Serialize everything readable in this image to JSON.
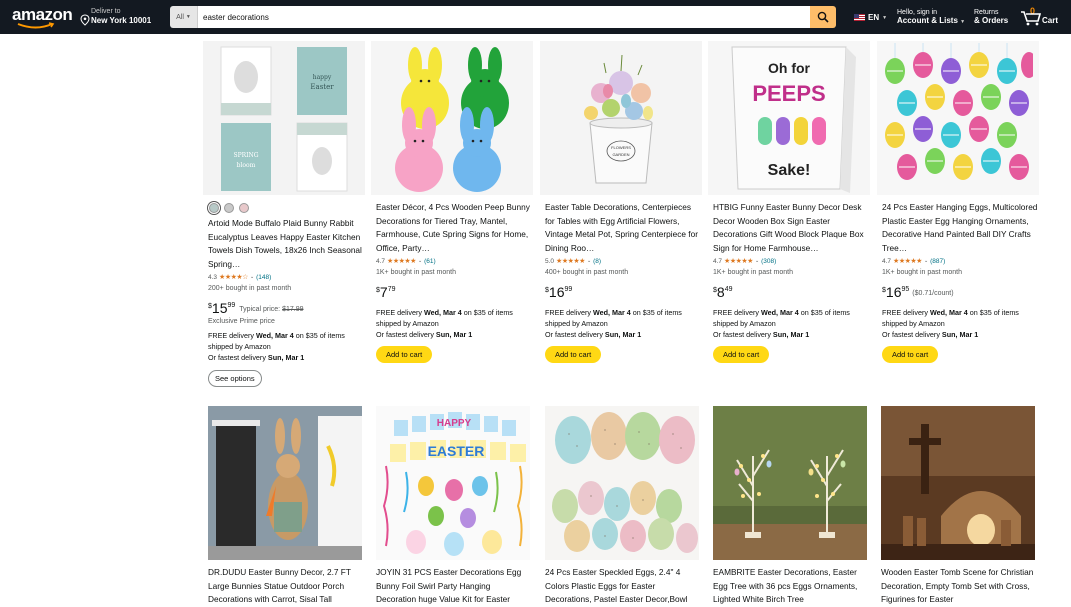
{
  "header": {
    "logo": "amazon",
    "deliver_line1": "Deliver to",
    "deliver_line2": "New York 10001",
    "search_category": "All",
    "search_query": "easter decorations",
    "language": "EN",
    "account_line1": "Hello, sign in",
    "account_line2": "Account & Lists",
    "returns_line1": "Returns",
    "returns_line2": "& Orders",
    "cart_count": "0",
    "cart_label": "Cart"
  },
  "products_row1": [
    {
      "title": "Artoid Mode Buffalo Plaid Bunny Rabbit Eucalyptus Leaves Happy Easter Kitchen Towels Dish Towels, 18x26 Inch Seasonal Spring…",
      "rating": "4.3",
      "stars": "★★★★☆",
      "reviews": "(148)",
      "bought": "200+ bought in past month",
      "price_sym": "$",
      "price_whole": "15",
      "price_frac": "99",
      "typical_label": "Typical price:",
      "typical_price": "$17.99",
      "note": "Exclusive Prime price",
      "delivery_1": "FREE delivery",
      "delivery_date": "Wed, Mar 4",
      "delivery_2": "on $35 of items shipped by Amazon",
      "fastest": "Or fastest delivery",
      "fastest_date": "Sun, Mar 1",
      "button": "See options"
    },
    {
      "title": "Easter Décor, 4 Pcs Wooden Peep Bunny Decorations for Tiered Tray, Mantel, Farmhouse, Cute Spring Signs for Home, Office, Party…",
      "rating": "4.7",
      "stars": "★★★★★",
      "reviews": "(61)",
      "bought": "1K+ bought in past month",
      "price_sym": "$",
      "price_whole": "7",
      "price_frac": "79",
      "delivery_1": "FREE delivery",
      "delivery_date": "Wed, Mar 4",
      "delivery_2": "on $35 of items shipped by Amazon",
      "fastest": "Or fastest delivery",
      "fastest_date": "Sun, Mar 1",
      "button": "Add to cart"
    },
    {
      "title": "Easter Table Decorations, Centerpieces for Tables with Egg Artificial Flowers, Vintage Metal Pot, Spring Centerpiece for Dining Roo…",
      "rating": "5.0",
      "stars": "★★★★★",
      "reviews": "(8)",
      "bought": "400+ bought in past month",
      "price_sym": "$",
      "price_whole": "16",
      "price_frac": "99",
      "delivery_1": "FREE delivery",
      "delivery_date": "Wed, Mar 4",
      "delivery_2": "on $35 of items shipped by Amazon",
      "fastest": "Or fastest delivery",
      "fastest_date": "Sun, Mar 1",
      "button": "Add to cart"
    },
    {
      "title": "HTBIG Funny Easter Bunny Decor Desk Decor Wooden Box Sign Easter Decorations Gift Wood Block Plaque Box Sign for Home Farmhouse…",
      "rating": "4.7",
      "stars": "★★★★★",
      "reviews": "(308)",
      "bought": "1K+ bought in past month",
      "price_sym": "$",
      "price_whole": "8",
      "price_frac": "49",
      "delivery_1": "FREE delivery",
      "delivery_date": "Wed, Mar 4",
      "delivery_2": "on $35 of items shipped by Amazon",
      "fastest": "Or fastest delivery",
      "fastest_date": "Sun, Mar 1",
      "button": "Add to cart"
    },
    {
      "title": "24 Pcs Easter Hanging Eggs, Multicolored Plastic Easter Egg Hanging Ornaments, Decorative Hand Painted Ball DIY Crafts Tree…",
      "rating": "4.7",
      "stars": "★★★★★",
      "reviews": "(887)",
      "bought": "1K+ bought in past month",
      "price_sym": "$",
      "price_whole": "16",
      "price_frac": "95",
      "per_unit": "($0.71/count)",
      "delivery_1": "FREE delivery",
      "delivery_date": "Wed, Mar 4",
      "delivery_2": "on $35 of items shipped by Amazon",
      "fastest": "Or fastest delivery",
      "fastest_date": "Sun, Mar 1",
      "button": "Add to cart"
    }
  ],
  "products_row2": [
    {
      "title": "DR.DUDU Easter Bunny Decor, 2.7 FT Large Bunnies Statue Outdoor Porch Decorations with Carrot, Sisal Tall"
    },
    {
      "title": "JOYIN 31 PCS Easter Decorations Egg Bunny Foil Swirl Party Hanging Decoration huge Value Kit for Easter"
    },
    {
      "title": "24 Pcs Easter Speckled Eggs, 2.4\" 4 Colors Plastic Eggs for Easter Decorations, Pastel Easter Decor,Bowl"
    },
    {
      "title": "EAMBRITE Easter Decorations, Easter Egg Tree with 36 pcs Eggs Ornaments, Lighted White Birch Tree"
    },
    {
      "title": "Wooden Easter Tomb Scene for Christian Decoration, Empty Tomb Set with Cross, Figurines for Easter"
    }
  ],
  "image_texts": {
    "towel_1": "happy",
    "towel_2": "Easter",
    "towel_3": "SPRING",
    "towel_4": "bloom",
    "pot_1": "FLOWERS",
    "pot_2": "GARDEN",
    "sign_1": "Oh for",
    "sign_2": "PEEPS",
    "sign_3": "Sake!",
    "banner_1": "HAPPY",
    "banner_2": "EASTER"
  },
  "colors": {
    "header_bg": "#131921",
    "search_btn": "#febd69",
    "add_to_cart": "#ffd814",
    "star": "#de7921",
    "link": "#007185"
  }
}
